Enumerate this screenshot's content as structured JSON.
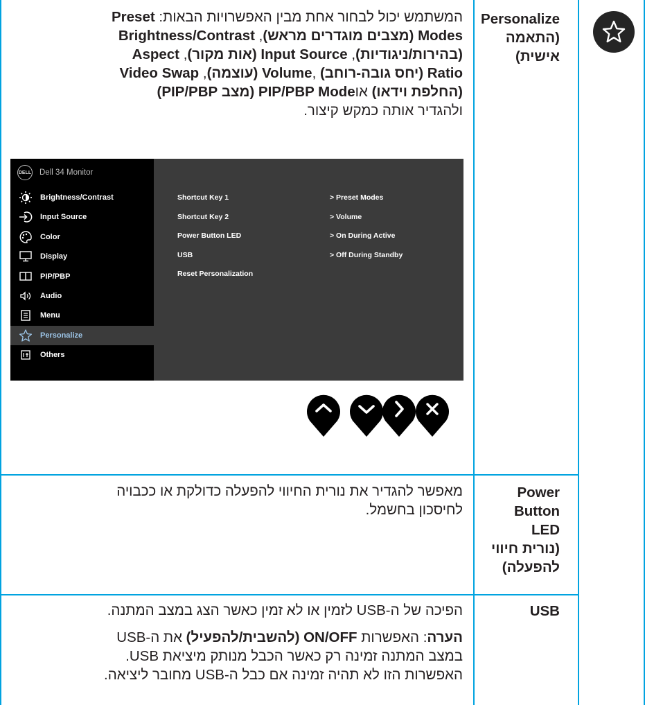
{
  "personalize": {
    "label": [
      "Personalize",
      "(התאמה",
      "אישית)"
    ],
    "desc": [
      [
        {
          "t": "המשתמש יכול לבחור אחת מבין האפשרויות הבאות: "
        },
        {
          "t": "Preset",
          "b": true
        }
      ],
      [
        {
          "t": "Modes (מצבים מוגדרים מראש)",
          "b": true
        },
        {
          "t": ", "
        },
        {
          "t": "Brightness/Contrast",
          "b": true
        }
      ],
      [
        {
          "t": "(בהירות/ניגודיות)",
          "b": true
        },
        {
          "t": ", "
        },
        {
          "t": "Input Source (אות מקור)",
          "b": true
        },
        {
          "t": ", "
        },
        {
          "t": "Aspect",
          "b": true
        }
      ],
      [
        {
          "t": "Ratio (יחס גובה-רוחב)",
          "b": true
        },
        {
          "t": " ,"
        },
        {
          "t": "Volume (עוצמה)",
          "b": true
        },
        {
          "t": ", "
        },
        {
          "t": "Video Swap",
          "b": true
        }
      ],
      [
        {
          "t": "(החלפת וידאו)",
          "b": true
        },
        {
          "t": " או"
        },
        {
          "t": "PIP/PBP Mode (מצב PIP/PBP)",
          "b": true
        }
      ],
      [
        {
          "t": "ולהגדיר אותה כמקש קיצור."
        }
      ]
    ]
  },
  "osd": {
    "logo": "DELL",
    "title": "Dell 34 Monitor",
    "menu": [
      {
        "label": "Brightness/Contrast",
        "icon": "brightness-icon"
      },
      {
        "label": "Input Source",
        "icon": "input-source-icon"
      },
      {
        "label": "Color",
        "icon": "color-icon"
      },
      {
        "label": "Display",
        "icon": "display-icon"
      },
      {
        "label": "PIP/PBP",
        "icon": "pip-pbp-icon"
      },
      {
        "label": "Audio",
        "icon": "audio-icon"
      },
      {
        "label": "Menu",
        "icon": "menu-icon"
      },
      {
        "label": "Personalize",
        "icon": "star-icon",
        "active": true
      },
      {
        "label": "Others",
        "icon": "others-icon"
      }
    ],
    "settings": [
      {
        "name": "Shortcut Key 1",
        "value": "> Preset Modes"
      },
      {
        "name": "Shortcut Key 2",
        "value": "> Volume"
      },
      {
        "name": "Power Button LED",
        "value": "> On During Active"
      },
      {
        "name": "USB",
        "value": "> Off During Standby"
      },
      {
        "name": "Reset Personalization",
        "value": ""
      }
    ]
  },
  "buttons": [
    "up-button",
    "down-button",
    "right-button",
    "close-button"
  ],
  "power_led": {
    "label": [
      "Power",
      "Button",
      "LED",
      "(נורית חיווי",
      "להפעלה)"
    ],
    "desc": [
      [
        {
          "t": "מאפשר להגדיר את נורית החיווי להפעלה כדולקת או ככבויה"
        }
      ],
      [
        {
          "t": "לחיסכון בחשמל."
        }
      ]
    ]
  },
  "usb": {
    "label": [
      "USB"
    ],
    "desc1": [
      [
        {
          "t": "הפיכה של ה-USB לזמין או לא זמין כאשר הצג במצב המתנה."
        }
      ]
    ],
    "desc2": [
      [
        {
          "t": "הערה",
          "b": true
        },
        {
          "t": ": האפשרות "
        },
        {
          "t": "ON/OFF (להשבית/להפעיל)",
          "b": true
        },
        {
          "t": " את ה-USB"
        }
      ],
      [
        {
          "t": "במצב המתנה זמינה רק כאשר הכבל מנותק מיציאת USB."
        }
      ],
      [
        {
          "t": "האפשרות הזו לא תהיה זמינה אם כבל ה-USB מחובר ליציאה."
        }
      ]
    ]
  },
  "colors": {
    "rule": "#00a3e0",
    "badge": "#252525",
    "osd_side": "#000000",
    "osd_main": "#3b3b3b",
    "active_label": "#9ec7ea"
  }
}
